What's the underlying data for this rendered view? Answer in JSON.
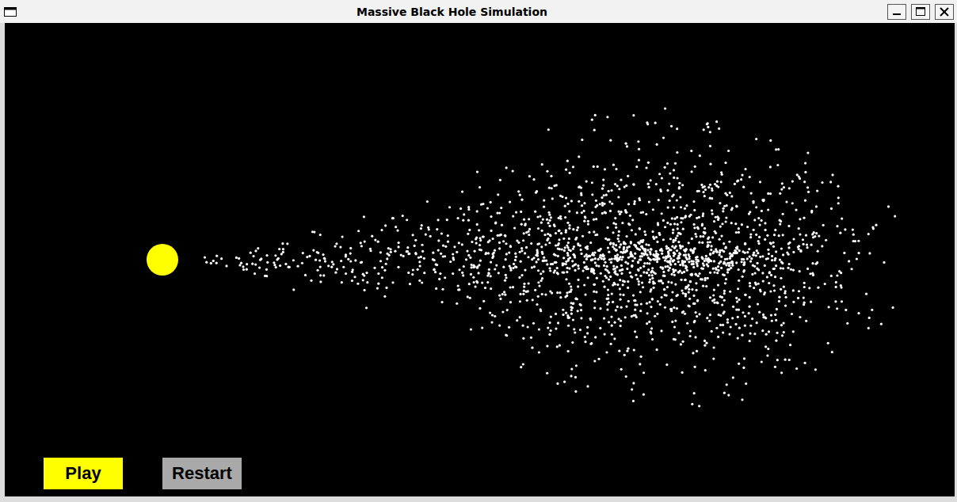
{
  "window": {
    "title": "Massive Black Hole Simulation"
  },
  "buttons": [
    {
      "label": "Play",
      "selected": true
    },
    {
      "label": "Restart",
      "selected": false
    }
  ]
}
